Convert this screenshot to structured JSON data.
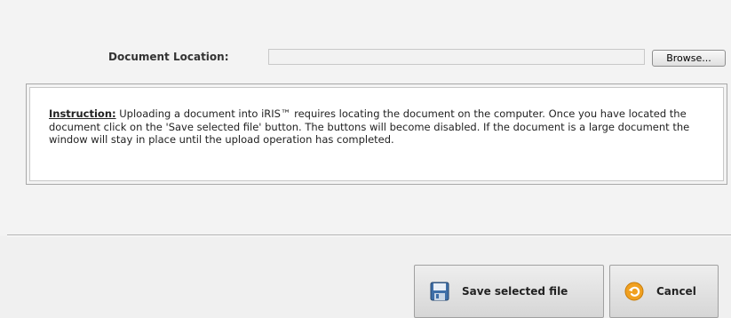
{
  "upload": {
    "location_label": "Document Location:",
    "location_value": "",
    "browse_label": "Browse..."
  },
  "instruction": {
    "heading": "Instruction:",
    "body": " Uploading a document into iRIS™ requires locating the document on the computer. Once you have located the document click on the 'Save selected file' button. The buttons will become disabled. If the document is a large document the window will stay in place until the upload operation has completed."
  },
  "actions": {
    "save_label": "Save selected file",
    "save_icon": "floppy-disk-icon",
    "cancel_label": "Cancel",
    "cancel_icon": "undo-circle-icon",
    "cancel_icon_color": "#f0a020"
  }
}
